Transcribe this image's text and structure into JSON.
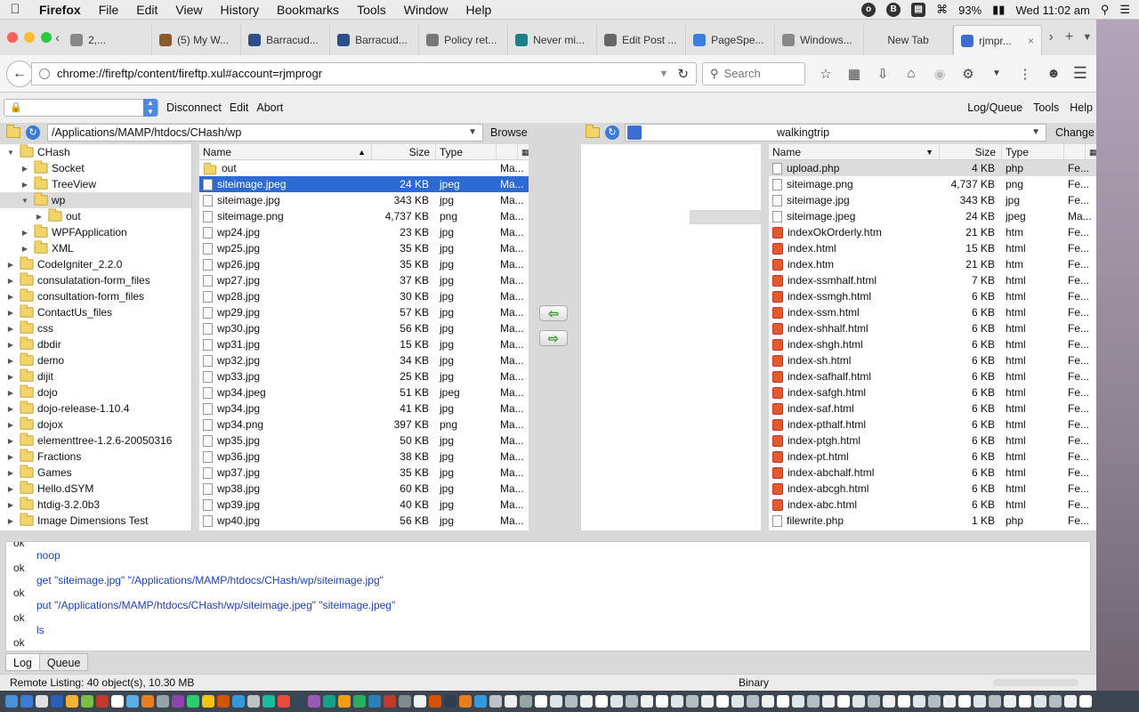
{
  "menubar": {
    "app": "Firefox",
    "items": [
      "File",
      "Edit",
      "View",
      "History",
      "Bookmarks",
      "Tools",
      "Window",
      "Help"
    ],
    "battery": "93%",
    "clock": "Wed 11:02 am"
  },
  "tabs": [
    {
      "label": "2,...",
      "icon": "page-icon",
      "color": "#888888"
    },
    {
      "label": "(5) My W...",
      "icon": "site-icon",
      "color": "#8a5a2b"
    },
    {
      "label": "Barracud...",
      "icon": "barracuda-icon",
      "color": "#2a4f8a"
    },
    {
      "label": "Barracud...",
      "icon": "barracuda-icon",
      "color": "#2a4f8a"
    },
    {
      "label": "Policy ret...",
      "icon": "gear-icon",
      "color": "#777777"
    },
    {
      "label": "Never mi...",
      "icon": "play-icon",
      "color": "#1e7f8c"
    },
    {
      "label": "Edit Post ...",
      "icon": "wordpress-icon",
      "color": "#666666"
    },
    {
      "label": "PageSpe...",
      "icon": "pagespeed-icon",
      "color": "#3b7de0"
    },
    {
      "label": "Windows...",
      "icon": "windows-icon",
      "color": "#888888"
    },
    {
      "label": "New Tab",
      "icon": "",
      "color": ""
    },
    {
      "label": "rjmpr...",
      "icon": "fireftp-icon",
      "color": "#3a6fcf"
    }
  ],
  "nav": {
    "url": "chrome://fireftp/content/fireftp.xul#account=rjmprogr",
    "search_placeholder": "Search"
  },
  "ftp_toolbar": {
    "disconnect": "Disconnect",
    "edit": "Edit",
    "abort": "Abort",
    "log_queue": "Log/Queue",
    "tools": "Tools",
    "help": "Help"
  },
  "local": {
    "path": "/Applications/MAMP/htdocs/CHash/wp",
    "browse": "Browse",
    "headers": {
      "name": "Name",
      "size": "Size",
      "type": "Type",
      "date": ""
    },
    "tree": [
      {
        "label": "CHash",
        "depth": 0,
        "open": true,
        "sel": false
      },
      {
        "label": "Socket",
        "depth": 1,
        "open": false,
        "sel": false
      },
      {
        "label": "TreeView",
        "depth": 1,
        "open": false,
        "sel": false
      },
      {
        "label": "wp",
        "depth": 1,
        "open": true,
        "sel": true
      },
      {
        "label": "out",
        "depth": 2,
        "open": false,
        "sel": false
      },
      {
        "label": "WPFApplication",
        "depth": 1,
        "open": false,
        "sel": false
      },
      {
        "label": "XML",
        "depth": 1,
        "open": false,
        "sel": false
      },
      {
        "label": "CodeIgniter_2.2.0",
        "depth": 0,
        "open": false,
        "sel": false
      },
      {
        "label": "consulatation-form_files",
        "depth": 0,
        "open": false,
        "sel": false
      },
      {
        "label": "consultation-form_files",
        "depth": 0,
        "open": false,
        "sel": false
      },
      {
        "label": "ContactUs_files",
        "depth": 0,
        "open": false,
        "sel": false
      },
      {
        "label": "css",
        "depth": 0,
        "open": false,
        "sel": false
      },
      {
        "label": "dbdir",
        "depth": 0,
        "open": false,
        "sel": false
      },
      {
        "label": "demo",
        "depth": 0,
        "open": false,
        "sel": false
      },
      {
        "label": "dijit",
        "depth": 0,
        "open": false,
        "sel": false
      },
      {
        "label": "dojo",
        "depth": 0,
        "open": false,
        "sel": false
      },
      {
        "label": "dojo-release-1.10.4",
        "depth": 0,
        "open": false,
        "sel": false
      },
      {
        "label": "dojox",
        "depth": 0,
        "open": false,
        "sel": false
      },
      {
        "label": "elementtree-1.2.6-20050316",
        "depth": 0,
        "open": false,
        "sel": false
      },
      {
        "label": "Fractions",
        "depth": 0,
        "open": false,
        "sel": false
      },
      {
        "label": "Games",
        "depth": 0,
        "open": false,
        "sel": false
      },
      {
        "label": "Hello.dSYM",
        "depth": 0,
        "open": false,
        "sel": false
      },
      {
        "label": "htdig-3.2.0b3",
        "depth": 0,
        "open": false,
        "sel": false
      },
      {
        "label": "Image Dimensions Test",
        "depth": 0,
        "open": false,
        "sel": false
      }
    ],
    "files": [
      {
        "name": "out",
        "size": "",
        "type": "",
        "date": "Ma...",
        "kind": "folder",
        "sel": false
      },
      {
        "name": "siteimage.jpeg",
        "size": "24 KB",
        "type": "jpeg",
        "date": "Ma...",
        "kind": "file",
        "sel": true
      },
      {
        "name": "siteimage.jpg",
        "size": "343 KB",
        "type": "jpg",
        "date": "Ma...",
        "kind": "file",
        "sel": false
      },
      {
        "name": "siteimage.png",
        "size": "4,737 KB",
        "type": "png",
        "date": "Ma...",
        "kind": "file",
        "sel": false
      },
      {
        "name": "wp24.jpg",
        "size": "23 KB",
        "type": "jpg",
        "date": "Ma...",
        "kind": "file",
        "sel": false
      },
      {
        "name": "wp25.jpg",
        "size": "35 KB",
        "type": "jpg",
        "date": "Ma...",
        "kind": "file",
        "sel": false
      },
      {
        "name": "wp26.jpg",
        "size": "35 KB",
        "type": "jpg",
        "date": "Ma...",
        "kind": "file",
        "sel": false
      },
      {
        "name": "wp27.jpg",
        "size": "37 KB",
        "type": "jpg",
        "date": "Ma...",
        "kind": "file",
        "sel": false
      },
      {
        "name": "wp28.jpg",
        "size": "30 KB",
        "type": "jpg",
        "date": "Ma...",
        "kind": "file",
        "sel": false
      },
      {
        "name": "wp29.jpg",
        "size": "57 KB",
        "type": "jpg",
        "date": "Ma...",
        "kind": "file",
        "sel": false
      },
      {
        "name": "wp30.jpg",
        "size": "56 KB",
        "type": "jpg",
        "date": "Ma...",
        "kind": "file",
        "sel": false
      },
      {
        "name": "wp31.jpg",
        "size": "15 KB",
        "type": "jpg",
        "date": "Ma...",
        "kind": "file",
        "sel": false
      },
      {
        "name": "wp32.jpg",
        "size": "34 KB",
        "type": "jpg",
        "date": "Ma...",
        "kind": "file",
        "sel": false
      },
      {
        "name": "wp33.jpg",
        "size": "25 KB",
        "type": "jpg",
        "date": "Ma...",
        "kind": "file",
        "sel": false
      },
      {
        "name": "wp34.jpeg",
        "size": "51 KB",
        "type": "jpeg",
        "date": "Ma...",
        "kind": "file",
        "sel": false
      },
      {
        "name": "wp34.jpg",
        "size": "41 KB",
        "type": "jpg",
        "date": "Ma...",
        "kind": "file",
        "sel": false
      },
      {
        "name": "wp34.png",
        "size": "397 KB",
        "type": "png",
        "date": "Ma...",
        "kind": "file",
        "sel": false
      },
      {
        "name": "wp35.jpg",
        "size": "50 KB",
        "type": "jpg",
        "date": "Ma...",
        "kind": "file",
        "sel": false
      },
      {
        "name": "wp36.jpg",
        "size": "38 KB",
        "type": "jpg",
        "date": "Ma...",
        "kind": "file",
        "sel": false
      },
      {
        "name": "wp37.jpg",
        "size": "35 KB",
        "type": "jpg",
        "date": "Ma...",
        "kind": "file",
        "sel": false
      },
      {
        "name": "wp38.jpg",
        "size": "60 KB",
        "type": "jpg",
        "date": "Ma...",
        "kind": "file",
        "sel": false
      },
      {
        "name": "wp39.jpg",
        "size": "40 KB",
        "type": "jpg",
        "date": "Ma...",
        "kind": "file",
        "sel": false
      },
      {
        "name": "wp40.jpg",
        "size": "56 KB",
        "type": "jpg",
        "date": "Ma...",
        "kind": "file",
        "sel": false
      }
    ]
  },
  "remote": {
    "path": "walkingtrip",
    "change": "Change",
    "headers": {
      "name": "Name",
      "size": "Size",
      "type": "Type",
      "date": ""
    },
    "files": [
      {
        "name": "upload.php",
        "size": "4 KB",
        "type": "php",
        "date": "Fe...",
        "kind": "file",
        "sel": false
      },
      {
        "name": "siteimage.png",
        "size": "4,737 KB",
        "type": "png",
        "date": "Fe...",
        "kind": "file",
        "sel": false
      },
      {
        "name": "siteimage.jpg",
        "size": "343 KB",
        "type": "jpg",
        "date": "Fe...",
        "kind": "file",
        "sel": false
      },
      {
        "name": "siteimage.jpeg",
        "size": "24 KB",
        "type": "jpeg",
        "date": "Ma...",
        "kind": "file",
        "sel": false
      },
      {
        "name": "indexOkOrderly.htm",
        "size": "21 KB",
        "type": "htm",
        "date": "Fe...",
        "kind": "html",
        "sel": false
      },
      {
        "name": "index.html",
        "size": "15 KB",
        "type": "html",
        "date": "Fe...",
        "kind": "html",
        "sel": false
      },
      {
        "name": "index.htm",
        "size": "21 KB",
        "type": "htm",
        "date": "Fe...",
        "kind": "html",
        "sel": false
      },
      {
        "name": "index-ssmhalf.html",
        "size": "7 KB",
        "type": "html",
        "date": "Fe...",
        "kind": "html",
        "sel": false
      },
      {
        "name": "index-ssmgh.html",
        "size": "6 KB",
        "type": "html",
        "date": "Fe...",
        "kind": "html",
        "sel": false
      },
      {
        "name": "index-ssm.html",
        "size": "6 KB",
        "type": "html",
        "date": "Fe...",
        "kind": "html",
        "sel": false
      },
      {
        "name": "index-shhalf.html",
        "size": "6 KB",
        "type": "html",
        "date": "Fe...",
        "kind": "html",
        "sel": false
      },
      {
        "name": "index-shgh.html",
        "size": "6 KB",
        "type": "html",
        "date": "Fe...",
        "kind": "html",
        "sel": false
      },
      {
        "name": "index-sh.html",
        "size": "6 KB",
        "type": "html",
        "date": "Fe...",
        "kind": "html",
        "sel": false
      },
      {
        "name": "index-safhalf.html",
        "size": "6 KB",
        "type": "html",
        "date": "Fe...",
        "kind": "html",
        "sel": false
      },
      {
        "name": "index-safgh.html",
        "size": "6 KB",
        "type": "html",
        "date": "Fe...",
        "kind": "html",
        "sel": false
      },
      {
        "name": "index-saf.html",
        "size": "6 KB",
        "type": "html",
        "date": "Fe...",
        "kind": "html",
        "sel": false
      },
      {
        "name": "index-pthalf.html",
        "size": "6 KB",
        "type": "html",
        "date": "Fe...",
        "kind": "html",
        "sel": false
      },
      {
        "name": "index-ptgh.html",
        "size": "6 KB",
        "type": "html",
        "date": "Fe...",
        "kind": "html",
        "sel": false
      },
      {
        "name": "index-pt.html",
        "size": "6 KB",
        "type": "html",
        "date": "Fe...",
        "kind": "html",
        "sel": false
      },
      {
        "name": "index-abchalf.html",
        "size": "6 KB",
        "type": "html",
        "date": "Fe...",
        "kind": "html",
        "sel": false
      },
      {
        "name": "index-abcgh.html",
        "size": "6 KB",
        "type": "html",
        "date": "Fe...",
        "kind": "html",
        "sel": false
      },
      {
        "name": "index-abc.html",
        "size": "6 KB",
        "type": "html",
        "date": "Fe...",
        "kind": "html",
        "sel": false
      },
      {
        "name": "filewrite.php",
        "size": "1 KB",
        "type": "php",
        "date": "Fe...",
        "kind": "file",
        "sel": false
      }
    ]
  },
  "log": {
    "lines": [
      {
        "kind": "ok",
        "text": "ok"
      },
      {
        "kind": "cmd",
        "text": "noop"
      },
      {
        "kind": "ok",
        "text": "ok"
      },
      {
        "kind": "cmd",
        "text": "get \"siteimage.jpg\" \"/Applications/MAMP/htdocs/CHash/wp/siteimage.jpg\""
      },
      {
        "kind": "ok",
        "text": "ok"
      },
      {
        "kind": "cmd",
        "text": "put \"/Applications/MAMP/htdocs/CHash/wp/siteimage.jpeg\" \"siteimage.jpeg\""
      },
      {
        "kind": "ok",
        "text": "ok"
      },
      {
        "kind": "cmd",
        "text": "ls"
      },
      {
        "kind": "ok",
        "text": "ok"
      }
    ],
    "tabs": [
      "Log",
      "Queue"
    ]
  },
  "status": {
    "left": "Remote Listing: 40 object(s), 10.30 MB",
    "mode": "Binary"
  }
}
